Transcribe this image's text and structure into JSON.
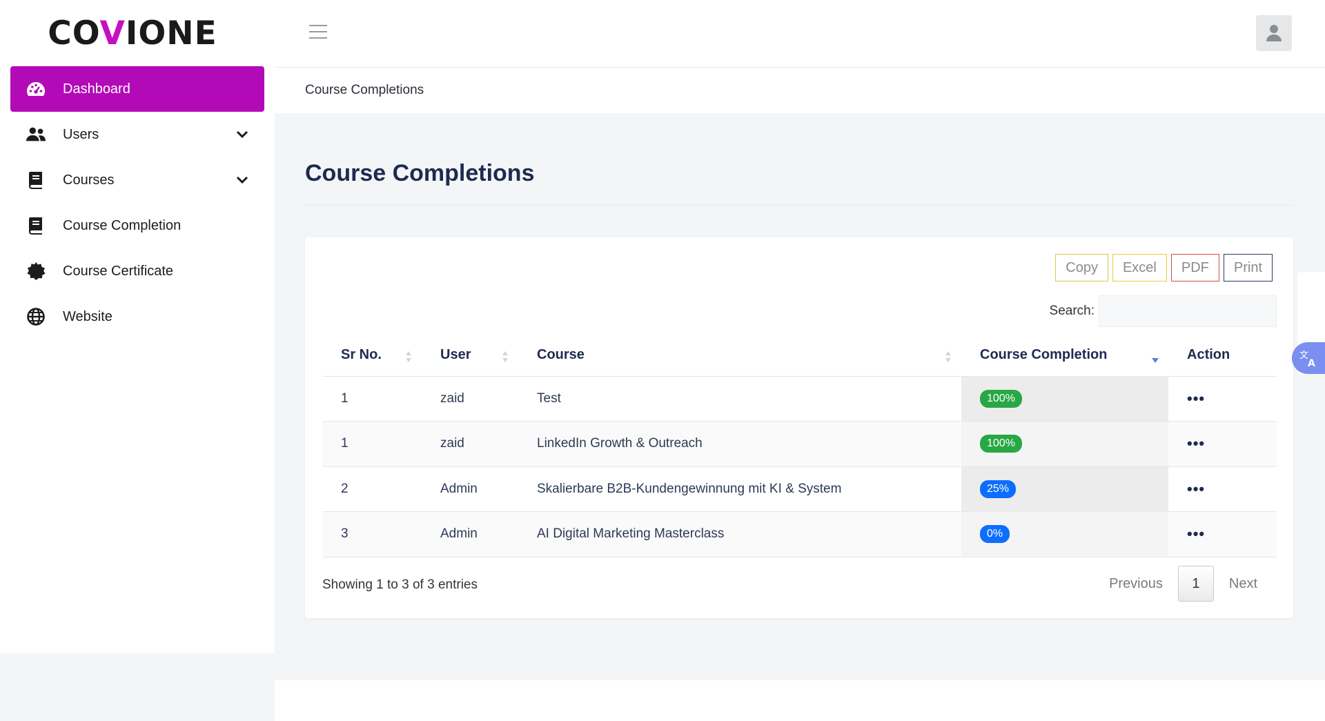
{
  "brand": {
    "part1": "CO",
    "part2": "V",
    "part3": "IONE"
  },
  "sidebar": {
    "items": [
      {
        "label": "Dashboard",
        "icon": "dashboard-icon"
      },
      {
        "label": "Users",
        "icon": "users-icon"
      },
      {
        "label": "Courses",
        "icon": "book-icon"
      },
      {
        "label": "Course Completion",
        "icon": "book-icon"
      },
      {
        "label": "Course Certificate",
        "icon": "certificate-icon"
      },
      {
        "label": "Website",
        "icon": "globe-icon"
      }
    ]
  },
  "breadcrumb": "Course Completions",
  "page_title": "Course Completions",
  "toolbar": {
    "copy": "Copy",
    "excel": "Excel",
    "pdf": "PDF",
    "print": "Print"
  },
  "search": {
    "label": "Search:",
    "value": ""
  },
  "table": {
    "headers": [
      "Sr No.",
      "User",
      "Course",
      "Course Completion",
      "Action"
    ],
    "rows": [
      {
        "sr": "1",
        "user": "zaid",
        "course": "Test",
        "completion": "100%",
        "status_color": "#28a745"
      },
      {
        "sr": "1",
        "user": "zaid",
        "course": "LinkedIn Growth & Outreach",
        "completion": "100%",
        "status_color": "#28a745"
      },
      {
        "sr": "2",
        "user": "Admin",
        "course": "Skalierbare B2B-Kundengewinnung mit KI & System",
        "completion": "25%",
        "status_color": "#0d6efd"
      },
      {
        "sr": "3",
        "user": "Admin",
        "course": "AI Digital Marketing Masterclass",
        "completion": "0%",
        "status_color": "#0d6efd"
      }
    ],
    "action_glyph": "•••"
  },
  "footer": {
    "info": "Showing 1 to 3 of 3 entries",
    "previous": "Previous",
    "page": "1",
    "next": "Next"
  },
  "colors": {
    "accent": "#b30ab8",
    "success": "#28a745",
    "primary": "#0d6efd"
  }
}
